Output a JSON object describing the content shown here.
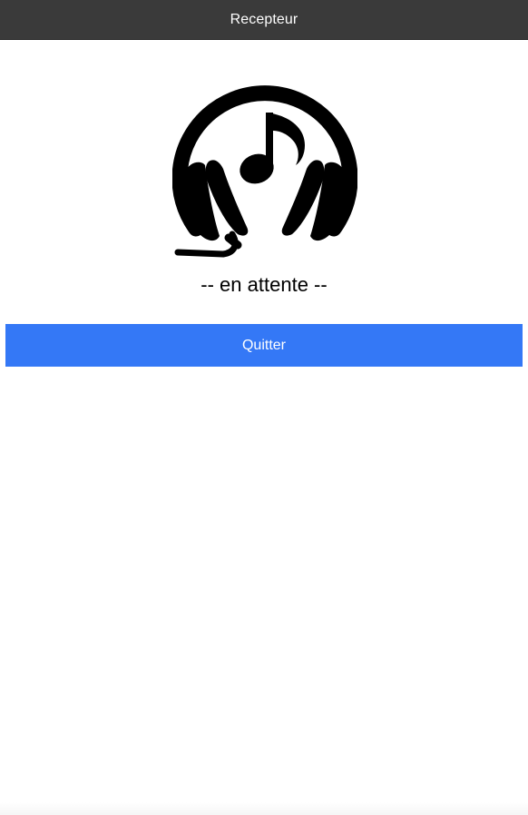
{
  "header": {
    "title": "Recepteur"
  },
  "main": {
    "logo_icon": "headphones-music-note-icon",
    "status_text": "-- en attente --",
    "quit_label": "Quitter"
  },
  "colors": {
    "topbar": "#3a3a3a",
    "button": "#3478f6",
    "button_text": "#ffffff",
    "icon": "#000000"
  }
}
